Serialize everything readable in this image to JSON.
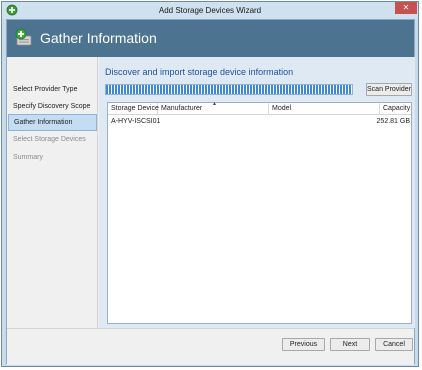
{
  "window": {
    "title": "Add Storage Devices Wizard",
    "close_glyph": "✕",
    "colors": {
      "header": "#4c7390",
      "accent": "#20509a",
      "progress": "#3f88d8",
      "close": "#c75050"
    }
  },
  "header": {
    "title": "Gather Information",
    "icon": "add-storage-icon"
  },
  "nav": {
    "items": [
      {
        "label": "Select Provider Type",
        "state": "normal"
      },
      {
        "label": "Specify Discovery Scope",
        "state": "normal"
      },
      {
        "label": "Gather Information",
        "state": "active"
      },
      {
        "label": "Select Storage Devices",
        "state": "disabled"
      },
      {
        "label": "Summary",
        "state": "disabled"
      }
    ]
  },
  "main": {
    "section_title": "Discover and import storage device information",
    "progress_percent": 100,
    "scan_button": "Scan Provider",
    "grid": {
      "columns": [
        "Storage Device",
        "Manufacturer",
        "Model",
        "Capacity"
      ],
      "sort_indicator": "▲",
      "rows": [
        {
          "storage_device": "A-HYV-ISCSI01",
          "manufacturer": "",
          "model": "",
          "capacity": "252.81 GB"
        }
      ]
    }
  },
  "footer": {
    "previous": "Previous",
    "next": "Next",
    "cancel": "Cancel"
  }
}
